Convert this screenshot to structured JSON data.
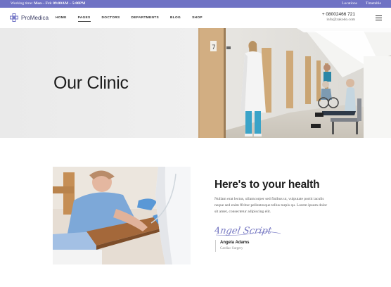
{
  "topbar": {
    "hours_prefix": "Working time: ",
    "hours_value": "Mon – Fri: 09:00AM – 5:00PM",
    "links": [
      "Locations",
      "Timetable"
    ]
  },
  "header": {
    "logo_text": "ProMedica",
    "nav": [
      {
        "label": "HOME",
        "active": false
      },
      {
        "label": "PAGES",
        "active": true
      },
      {
        "label": "DOCTORS",
        "active": false
      },
      {
        "label": "DEPARTMENTS",
        "active": false
      },
      {
        "label": "BLOG",
        "active": false
      },
      {
        "label": "SHOP",
        "active": false
      }
    ],
    "phone": "+ 08002466 721",
    "email": "info@zakodo.com",
    "menu_icon": "hamburger-icon"
  },
  "hero": {
    "title": "Our Clinic"
  },
  "intro": {
    "title": "Here's to your health",
    "text": "Nullam erat lectus, ullamcorper sed finibus ut, vulputate portit iaculis neque sed enim ffcitur pellentesque tellus turpis qu. Lorem ipsum dolor sit amet, consectetur adipiscing elit.",
    "signature": "Angel Script",
    "author_name": "Angela Adams",
    "author_role": "Cardiac Surgery"
  },
  "colors": {
    "topbar": "#6f72c4",
    "signature": "#7577c2",
    "logo": "#6f72c4"
  }
}
